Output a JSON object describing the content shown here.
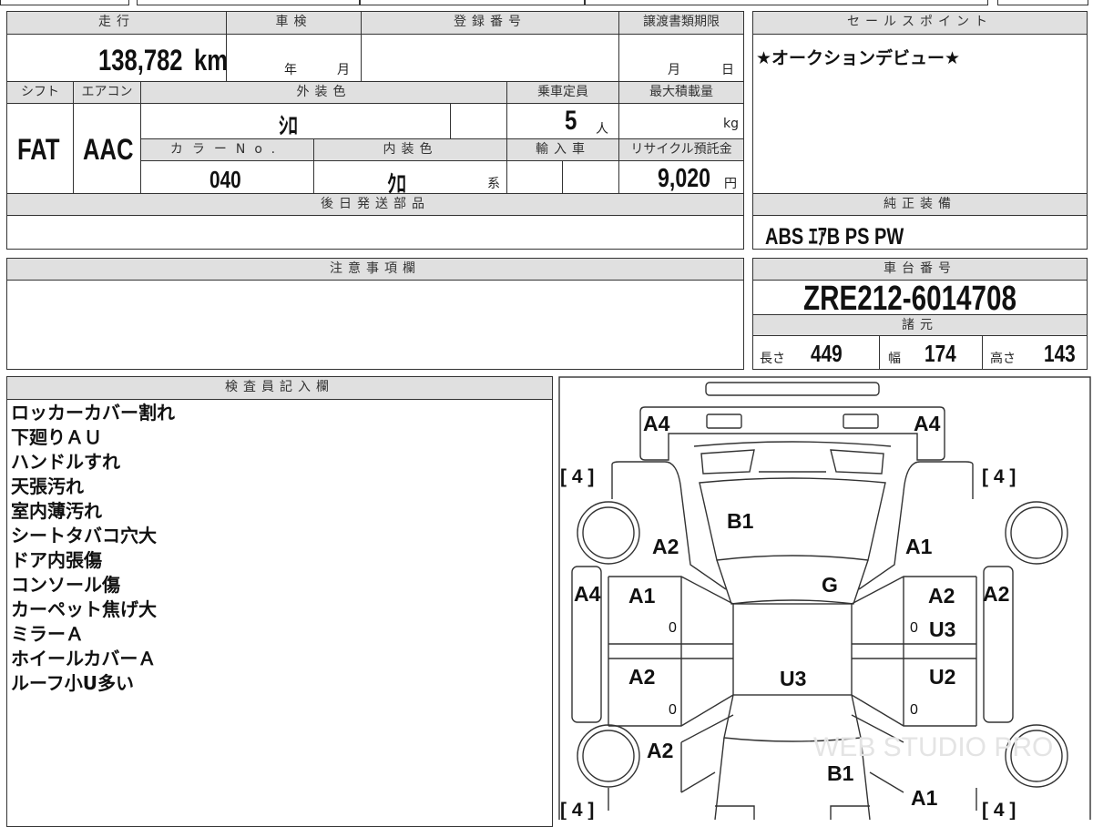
{
  "headers": {
    "mileage": "走行",
    "inspection": "車検",
    "registration": "登録番号",
    "transfer_deadline": "譲渡書類期限",
    "shift": "シフト",
    "aircon": "エアコン",
    "exterior_color": "外装色",
    "capacity": "乗車定員",
    "max_load": "最大積載量",
    "color_no": "カラーNo.",
    "interior_color": "内装色",
    "imported": "輸入車",
    "recycle_fee": "リサイクル預託金",
    "later_parts": "後日発送部品",
    "sales_point": "セールスポイント",
    "standard_equipment": "純正装備",
    "notes": "注意事項欄",
    "chassis_no": "車台番号",
    "specs": "諸元",
    "inspector": "検査員記入欄"
  },
  "values": {
    "mileage": "138,782",
    "mileage_unit": "km",
    "inspection_year": "年",
    "inspection_month": "月",
    "deadline_month": "月",
    "deadline_day": "日",
    "shift": "FAT",
    "aircon": "AAC",
    "exterior_color": "ｼﾛ",
    "capacity": "5",
    "capacity_unit": "人",
    "max_load_unit": "kg",
    "color_no": "040",
    "interior_color": "ｸﾛ",
    "interior_suffix": "系",
    "recycle_fee": "9,020",
    "recycle_unit": "円"
  },
  "sales_point": "★オークションデビュー★",
  "equipment": "ABS ｴｱB PS PW",
  "chassis_no": "ZRE212-6014708",
  "specs": {
    "length_label": "長さ",
    "length": "449",
    "width_label": "幅",
    "width": "174",
    "height_label": "高さ",
    "height": "143"
  },
  "inspector_notes": [
    "ロッカーカバー割れ",
    "下廻りＡＵ",
    "ハンドルすれ",
    "天張汚れ",
    "室内薄汚れ",
    "シートタバコ穴大",
    "ドア内張傷",
    "コンソール傷",
    "カーペット焦げ大",
    "ミラーＡ",
    "ホイールカバーＡ",
    "ルーフ小U多い"
  ],
  "diagram": {
    "front_bumper_l": "A4",
    "front_bumper_r": "A4",
    "hood": "B1",
    "fender_fl": "A2",
    "fender_fr": "A1",
    "roof_front": "G",
    "rocker_l": "A4",
    "rocker_r": "A2",
    "door_fl": "A1",
    "door_rl": "A2",
    "door_fr": "A2",
    "door_fr2": "U3",
    "door_rr": "U2",
    "roof": "U3",
    "quarter_rl": "A2",
    "trunk": "B1",
    "quarter_rr": "A1",
    "tire_fl": "[ 4 ]",
    "tire_fr": "[ 4 ]",
    "tire_rl": "[ 4 ]",
    "tire_rr": "[ 4 ]",
    "zero": "0"
  },
  "watermark": "WEB STUDIO PRO"
}
